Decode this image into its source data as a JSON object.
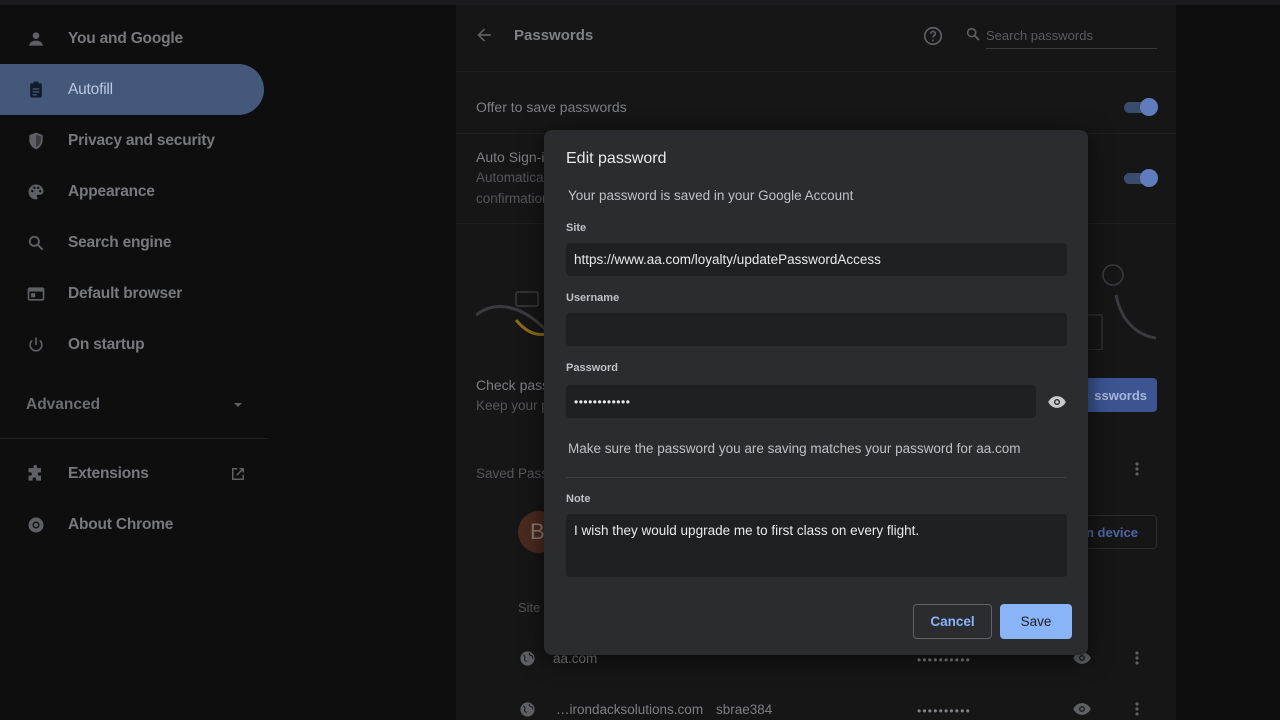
{
  "sidebar": {
    "items": [
      {
        "label": "You and Google",
        "icon": "person-icon"
      },
      {
        "label": "Autofill",
        "icon": "clipboard-icon",
        "active": true
      },
      {
        "label": "Privacy and security",
        "icon": "shield-icon"
      },
      {
        "label": "Appearance",
        "icon": "palette-icon"
      },
      {
        "label": "Search engine",
        "icon": "search-icon"
      },
      {
        "label": "Default browser",
        "icon": "browser-window-icon"
      },
      {
        "label": "On startup",
        "icon": "power-icon"
      }
    ],
    "advanced_label": "Advanced",
    "bottom_items": [
      {
        "label": "Extensions",
        "icon": "puzzle-icon"
      },
      {
        "label": "About Chrome",
        "icon": "chrome-icon"
      }
    ]
  },
  "passwords_page": {
    "title": "Passwords",
    "search_placeholder": "Search passwords",
    "offer_to_save_label": "Offer to save passwords",
    "auto_signin_label": "Auto Sign-i",
    "auto_signin_desc_1": "Automatica",
    "auto_signin_desc_2": "confirmation",
    "check_label": "Check pass",
    "check_desc": "Keep your p",
    "check_button": "sswords",
    "saved_label": "Saved Pass",
    "device_button": "n device",
    "avatar_letter": "B",
    "site_column": "Site",
    "rows": [
      {
        "site": "aa.com",
        "username": "",
        "password_mask": "••••••••••"
      },
      {
        "site": "…irondacksolutions.com",
        "username": "sbrae384",
        "password_mask": "••••••••••"
      }
    ]
  },
  "dialog": {
    "title": "Edit password",
    "subtitle": "Your password is saved in your Google Account",
    "site_label": "Site",
    "site_value": "https://www.aa.com/loyalty/updatePasswordAccess",
    "username_label": "Username",
    "username_value": "",
    "password_label": "Password",
    "password_value": "••••••••••••",
    "hint": "Make sure the password you are saving matches your password for aa.com",
    "note_label": "Note",
    "note_value": "I wish they would upgrade me to first class on every flight.",
    "cancel_label": "Cancel",
    "save_label": "Save"
  },
  "colors": {
    "accent": "#8ab4f8",
    "active_nav": "#44587a",
    "dialog_bg": "#2b2c2f"
  }
}
